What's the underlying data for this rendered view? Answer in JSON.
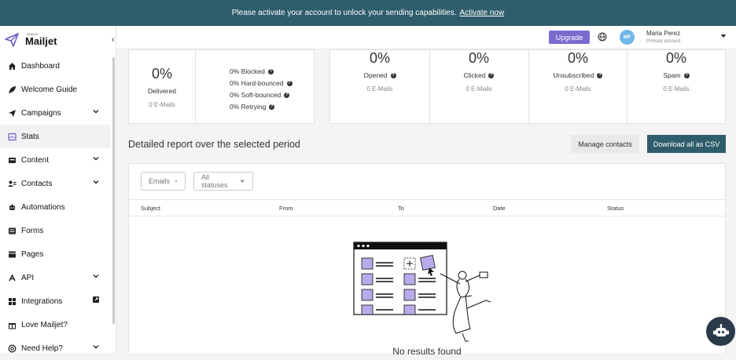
{
  "banner": {
    "text": "Please activate your account to unlock your sending capabilities.",
    "link": "Activate now"
  },
  "sidebar": {
    "logo_small": "SINCH",
    "logo_brand": "Mailjet",
    "items": [
      {
        "label": "Dashboard",
        "icon": "home-icon"
      },
      {
        "label": "Welcome Guide",
        "icon": "rocket-icon"
      },
      {
        "label": "Campaigns",
        "icon": "paper-plane-icon"
      },
      {
        "label": "Stats",
        "icon": "stats-icon"
      },
      {
        "label": "Content",
        "icon": "content-icon"
      },
      {
        "label": "Contacts",
        "icon": "contacts-icon"
      },
      {
        "label": "Automations",
        "icon": "automation-icon"
      },
      {
        "label": "Forms",
        "icon": "forms-icon"
      },
      {
        "label": "Pages",
        "icon": "pages-icon"
      },
      {
        "label": "API",
        "icon": "api-icon"
      },
      {
        "label": "Integrations",
        "icon": "integrations-icon"
      },
      {
        "label": "Love Mailjet?",
        "icon": "gift-icon"
      },
      {
        "label": "Need Help?",
        "icon": "help-icon"
      }
    ]
  },
  "topbar": {
    "upgrade_label": "Upgrade",
    "avatar_initials": "MP",
    "user_name": "Maria Perez",
    "user_sub": "Primary account"
  },
  "stats": {
    "delivered": {
      "pct": "0%",
      "label": "Delivered",
      "sub": "0 E-Mails"
    },
    "breakdown": [
      "0% Blocked",
      "0% Hard-bounced",
      "0% Soft-bounced",
      "0% Retrying"
    ],
    "opened": {
      "pct": "0%",
      "label": "Opened",
      "sub": "0 E-Mails"
    },
    "clicked": {
      "pct": "0%",
      "label": "Clicked",
      "sub": "0 E-Mails"
    },
    "unsubscribed": {
      "pct": "0%",
      "label": "Unsubscribed",
      "sub": "0 E-Mails"
    },
    "spam": {
      "pct": "0%",
      "label": "Spam",
      "sub": "0 E-Mails"
    }
  },
  "report": {
    "title": "Detailed report over the selected period",
    "manage_label": "Manage contacts",
    "csv_label": "Download all as CSV",
    "filter_emails": "Emails",
    "filter_statuses": "All statuses",
    "columns": [
      "Subject",
      "From",
      "To",
      "Date",
      "Status"
    ],
    "empty_text": "No results found"
  },
  "colors": {
    "banner": "#2f5d6b",
    "accent": "#7b6bd0",
    "csv_button": "#2f5d6b"
  }
}
